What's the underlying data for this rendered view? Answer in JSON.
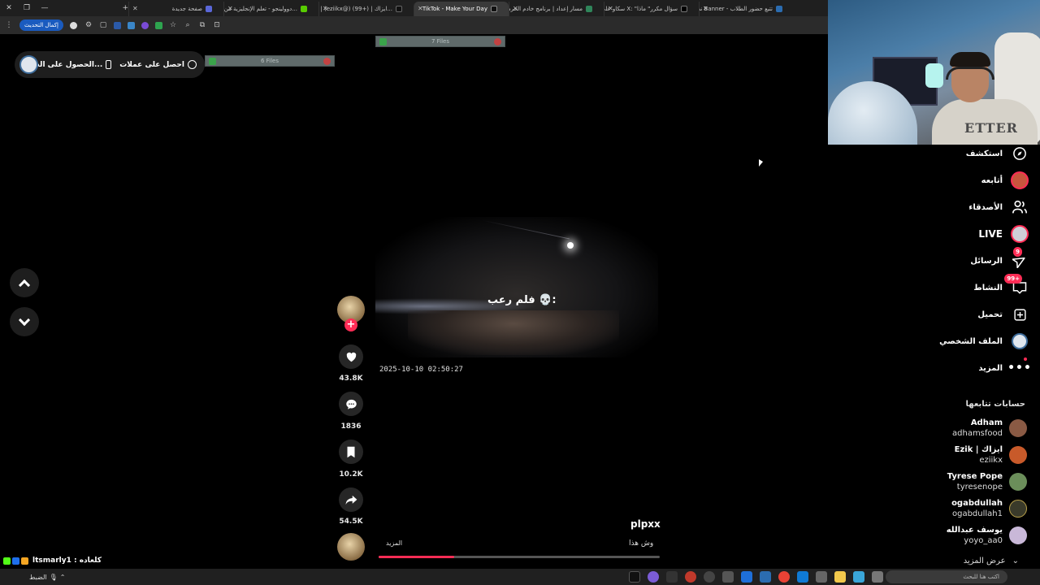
{
  "browser": {
    "tabs": [
      {
        "title": "نظام Banner - تتبع حضور الطلاب",
        "fav": "#2b6cb0"
      },
      {
        "title": "سكاو على X: \"سؤال مكرر\" ماذا",
        "fav": "#000000"
      },
      {
        "title": "مسار إعداد | برنامج خادم الحرمين",
        "fav": "#2f855a"
      },
      {
        "title": "TikTok - Make Your Day",
        "fav": "#111111",
        "active": true
      },
      {
        "title": "Ezik | (eziikx@) ايزاك | (+99)...",
        "fav": "#111111"
      },
      {
        "title": "دوولينجو - تعلم الإنجليزية من خ...",
        "fav": "#58cc02"
      },
      {
        "title": "صفحة جديدة",
        "fav": "#5a67d8"
      }
    ],
    "new_tab_symbol": "+",
    "update_button": "إكمال التحديث"
  },
  "promo": {
    "get_coins": "احصل على عملات",
    "get_app": "الحصول على الت..."
  },
  "files_bars": [
    "6 Files",
    "7 Files"
  ],
  "video": {
    "caption": "فلم رعب 💀:",
    "timestamp": "2025-10-10  02:50:27",
    "author": "plpxx",
    "description": "وش هذا",
    "more_label": "المزيد",
    "progress": 0.27
  },
  "actions": {
    "likes": "43.8K",
    "comments": "1836",
    "saves": "10.2K",
    "shares": "54.5K",
    "follow_symbol": "+"
  },
  "sidebar": {
    "items": [
      {
        "label": "استكشف",
        "icon": "compass-icon"
      },
      {
        "label": "أتابعه",
        "icon": "following-avatar-icon"
      },
      {
        "label": "الأصدقاء",
        "icon": "friends-icon"
      },
      {
        "label": "LIVE",
        "icon": "live-avatar-icon"
      },
      {
        "label": "الرسائل",
        "icon": "send-icon",
        "badge": "9"
      },
      {
        "label": "النشاط",
        "icon": "inbox-icon",
        "badge": "99+"
      },
      {
        "label": "تحميل",
        "icon": "upload-icon"
      },
      {
        "label": "الملف الشخصي",
        "icon": "profile-avatar-icon"
      },
      {
        "label": "المزيد",
        "icon": "more-icon"
      }
    ],
    "following_title": "حسابات تتابعها",
    "accounts": [
      {
        "name": "Adham",
        "username": "adhamsfood",
        "color": "#8a5a44"
      },
      {
        "name": "Ezik | ايزاك",
        "username": "eziikx",
        "color": "#c85a2a"
      },
      {
        "name": "Tyrese Pope",
        "username": "tyresenope",
        "color": "#6b8e5a"
      },
      {
        "name": "ogabdullah",
        "username": "ogabdullah1",
        "color": "#3a3a2a"
      },
      {
        "name": "يوسف عبدالله",
        "username": "yoyo_aa0",
        "color": "#c9b8d8"
      }
    ],
    "see_more": "عرض المزيد"
  },
  "chat": {
    "line": "ltsmarly1 : كلعاده"
  },
  "taskbar": {
    "left_text": "الضبط",
    "search_placeholder": "اكتب هنا للبحث"
  }
}
